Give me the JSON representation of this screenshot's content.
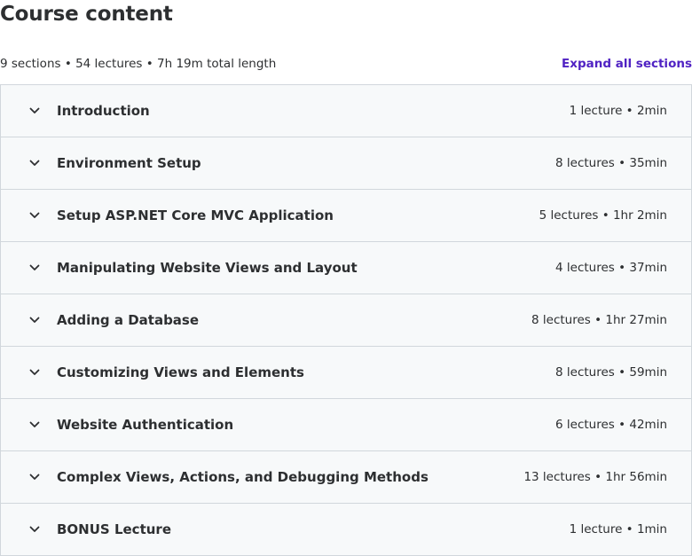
{
  "header": {
    "title": "Course content",
    "summary": "9 sections • 54 lectures • 7h 19m total length",
    "expand_label": "Expand all sections"
  },
  "colors": {
    "accent": "#5022c3",
    "row_bg": "#f7f9fa",
    "border": "#d1d7dc",
    "text": "#2d2f31"
  },
  "sections": [
    {
      "title": "Introduction",
      "meta": "1 lecture • 2min",
      "icon": "chevron-down-icon"
    },
    {
      "title": "Environment Setup",
      "meta": "8 lectures • 35min",
      "icon": "chevron-down-icon"
    },
    {
      "title": "Setup ASP.NET Core MVC Application",
      "meta": "5 lectures • 1hr 2min",
      "icon": "chevron-down-icon"
    },
    {
      "title": "Manipulating Website Views and Layout",
      "meta": "4 lectures • 37min",
      "icon": "chevron-down-icon"
    },
    {
      "title": "Adding a Database",
      "meta": "8 lectures • 1hr 27min",
      "icon": "chevron-down-icon"
    },
    {
      "title": "Customizing Views and Elements",
      "meta": "8 lectures • 59min",
      "icon": "chevron-down-icon"
    },
    {
      "title": "Website Authentication",
      "meta": "6 lectures • 42min",
      "icon": "chevron-down-icon"
    },
    {
      "title": "Complex Views, Actions, and Debugging Methods",
      "meta": "13 lectures • 1hr 56min",
      "icon": "chevron-down-icon"
    },
    {
      "title": "BONUS Lecture",
      "meta": "1 lecture • 1min",
      "icon": "chevron-down-icon"
    }
  ]
}
